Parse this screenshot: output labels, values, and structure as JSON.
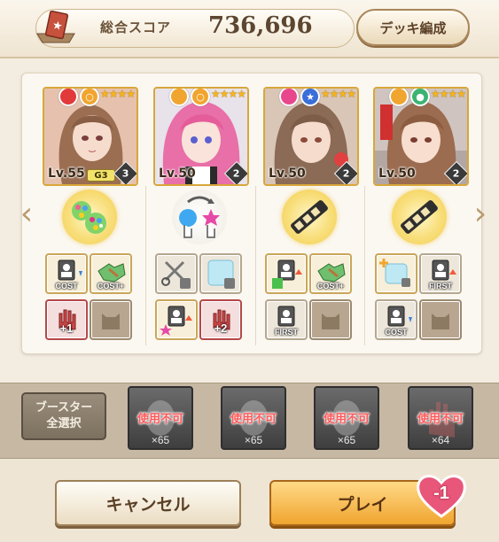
{
  "header": {
    "score_label": "総合スコア",
    "score_value": "736,696",
    "deck_button": "デッキ編成"
  },
  "characters": [
    {
      "level": "Lv.55",
      "grade": "G3",
      "count": "3",
      "stars": "★★★★",
      "attr_color": "#e23a3a",
      "role_color": "#f0a52f",
      "role_icon": "circle-icon"
    },
    {
      "level": "Lv.50",
      "grade": "",
      "count": "2",
      "stars": "★★★★",
      "attr_color": "#f0a52f",
      "role_color": "#f0a52f",
      "role_icon": "circle-icon"
    },
    {
      "level": "Lv.50",
      "grade": "",
      "count": "2",
      "stars": "★★★★",
      "attr_color": "#e9478d",
      "role_color": "#3a6ed8",
      "role_icon": "star-icon"
    },
    {
      "level": "Lv.50",
      "grade": "",
      "count": "2",
      "stars": "★★★★",
      "attr_color": "#f0a52f",
      "role_color": "#3cb371",
      "role_icon": "circle-icon"
    }
  ],
  "abilities": {
    "col1": [
      "COST",
      "COST+",
      "+1",
      ""
    ],
    "col2": [
      "",
      "",
      "",
      "+2"
    ],
    "col3": [
      "",
      "COST+",
      "FIRST",
      ""
    ],
    "col4": [
      "",
      "FIRST",
      "COST",
      ""
    ]
  },
  "booster": {
    "select_all_line1": "ブースター",
    "select_all_line2": "全選択",
    "items": [
      {
        "status": "使用不可",
        "qty": "×65"
      },
      {
        "status": "使用不可",
        "qty": "×65"
      },
      {
        "status": "使用不可",
        "qty": "×65"
      },
      {
        "status": "使用不可",
        "qty": "×64"
      }
    ]
  },
  "footer": {
    "cancel_label": "キャンセル",
    "play_label": "プレイ",
    "cost": "-1"
  },
  "colors": {
    "accent_gold": "#d8a73a",
    "play_orange": "#f0a52f",
    "unusable_red": "#ff5a5a",
    "heart_pink": "#e8567a"
  }
}
